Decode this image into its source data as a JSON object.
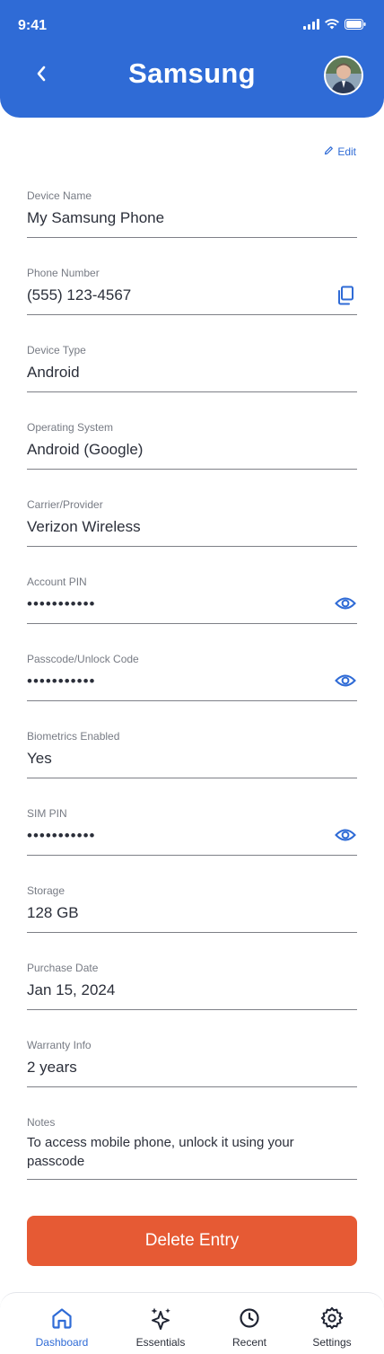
{
  "status": {
    "time": "9:41"
  },
  "header": {
    "title": "Samsung"
  },
  "edit_label": "Edit",
  "fields": [
    {
      "label": "Device Name",
      "value": "My Samsung Phone"
    },
    {
      "label": "Phone Number",
      "value": "(555) 123-4567",
      "icon": "copy-icon"
    },
    {
      "label": "Device Type",
      "value": "Android"
    },
    {
      "label": "Operating System",
      "value": "Android (Google)"
    },
    {
      "label": "Carrier/Provider",
      "value": "Verizon Wireless"
    },
    {
      "label": "Account PIN",
      "value": "•••••••••••",
      "icon": "eye-icon"
    },
    {
      "label": "Passcode/Unlock Code",
      "value": "•••••••••••",
      "icon": "eye-icon"
    },
    {
      "label": "Biometrics Enabled",
      "value": "Yes"
    },
    {
      "label": "SIM PIN",
      "value": "•••••••••••",
      "icon": "eye-icon"
    },
    {
      "label": "Storage",
      "value": "128 GB"
    },
    {
      "label": "Purchase Date",
      "value": "Jan 15, 2024"
    },
    {
      "label": "Warranty Info",
      "value": "2 years"
    },
    {
      "label": "Notes",
      "value": "To access mobile phone, unlock it using your passcode"
    }
  ],
  "delete_label": "Delete Entry",
  "tabs": [
    {
      "label": "Dashboard",
      "icon": "home-icon",
      "active": true
    },
    {
      "label": "Essentials",
      "icon": "sparkle-icon",
      "active": false
    },
    {
      "label": "Recent",
      "icon": "clock-icon",
      "active": false
    },
    {
      "label": "Settings",
      "icon": "gear-icon",
      "active": false
    }
  ],
  "colors": {
    "primary": "#2f6bd6",
    "danger": "#e65a34"
  }
}
